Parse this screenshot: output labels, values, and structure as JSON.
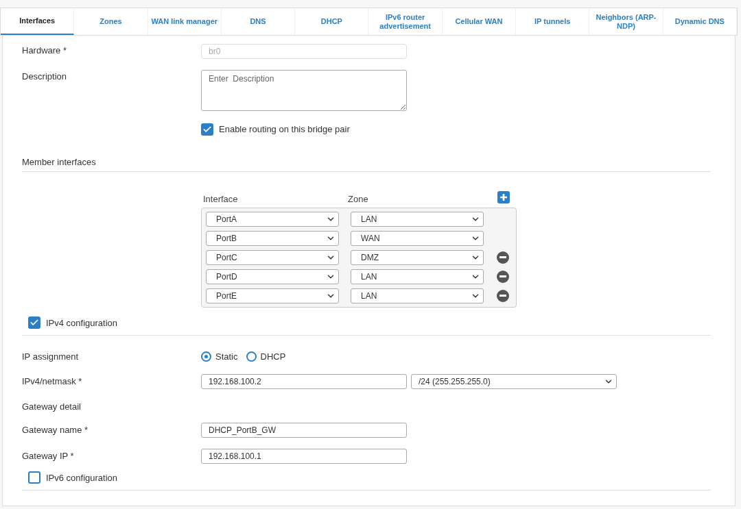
{
  "tabs": [
    {
      "label": "Interfaces",
      "selected": true
    },
    {
      "label": "Zones",
      "selected": false
    },
    {
      "label": "WAN link manager",
      "selected": false
    },
    {
      "label": "DNS",
      "selected": false
    },
    {
      "label": "DHCP",
      "selected": false
    },
    {
      "label": "IPv6 router advertisement",
      "selected": false
    },
    {
      "label": "Cellular WAN",
      "selected": false
    },
    {
      "label": "IP tunnels",
      "selected": false
    },
    {
      "label": "Neighbors (ARP-NDP)",
      "selected": false
    },
    {
      "label": "Dynamic DNS",
      "selected": false
    }
  ],
  "hardware": {
    "label": "Hardware *",
    "value": "br0",
    "disabled": true
  },
  "description": {
    "label": "Description",
    "placeholder": "Enter  Description"
  },
  "routing": {
    "label": "Enable routing on this bridge pair",
    "checked": true
  },
  "member_interfaces": {
    "title": "Member interfaces",
    "columns": [
      "Interface",
      "Zone"
    ],
    "rows": [
      {
        "interface": "PortA",
        "zone": "LAN",
        "removable": false
      },
      {
        "interface": "PortB",
        "zone": "WAN",
        "removable": false
      },
      {
        "interface": "PortC",
        "zone": "DMZ",
        "removable": true
      },
      {
        "interface": "PortD",
        "zone": "LAN",
        "removable": true
      },
      {
        "interface": "PortE",
        "zone": "LAN",
        "removable": true
      }
    ]
  },
  "ipv4": {
    "label": "IPv4 configuration",
    "checked": true
  },
  "ip_assignment": {
    "label": "IP assignment",
    "options": [
      {
        "label": "Static",
        "selected": true
      },
      {
        "label": "DHCP",
        "selected": false
      }
    ]
  },
  "ipv4_netmask": {
    "label": "IPv4/netmask *",
    "value": "192.168.100.2",
    "netmask": "/24 (255.255.255.0)"
  },
  "gateway_detail": "Gateway detail",
  "gateway_name": {
    "label": "Gateway name  *",
    "value": "DHCP_PortB_GW"
  },
  "gateway_ip": {
    "label": "Gateway IP  *",
    "value": "192.168.100.1"
  },
  "ipv6": {
    "label": "IPv6 configuration",
    "checked": false
  }
}
